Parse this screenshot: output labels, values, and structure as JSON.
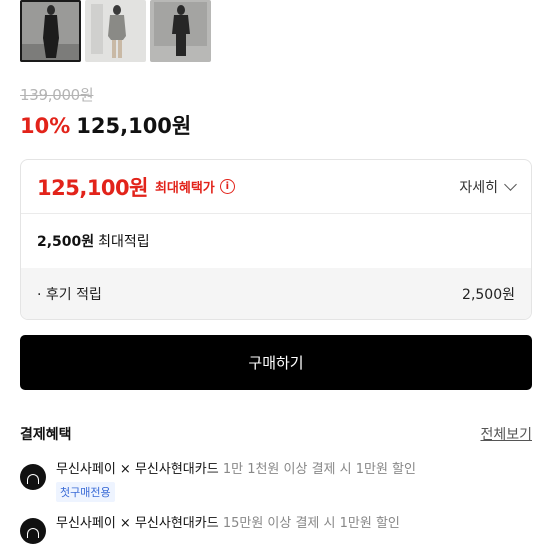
{
  "gallery": {
    "thumbnails": [
      {
        "name": "look-1",
        "selected": true
      },
      {
        "name": "look-2",
        "selected": false
      },
      {
        "name": "look-3",
        "selected": false
      }
    ]
  },
  "price": {
    "original": "139,000원",
    "discount": "10%",
    "sale": "125,100원"
  },
  "benefit": {
    "max_price": "125,100원",
    "max_label": "최대혜택가",
    "info_icon": "i",
    "detail_label": "자세히",
    "points_amount": "2,500원",
    "points_label": "최대적립",
    "review_label": "· 후기 적립",
    "review_value": "2,500원"
  },
  "buy_button": {
    "label": "구매하기"
  },
  "payment": {
    "title": "결제혜택",
    "see_all": "전체보기",
    "items": [
      {
        "name": "무신사페이 × 무신사현대카드",
        "condition": "1만 1천원 이상 결제 시 1만원 할인",
        "tag": "첫구매전용"
      },
      {
        "name": "무신사페이 × 무신사현대카드",
        "condition": "15만원 이상 결제 시 1만원 할인"
      }
    ]
  },
  "colors": {
    "accent_red": "#e2231a",
    "button_black": "#000000",
    "tag_blue": "#3a6bd6"
  }
}
